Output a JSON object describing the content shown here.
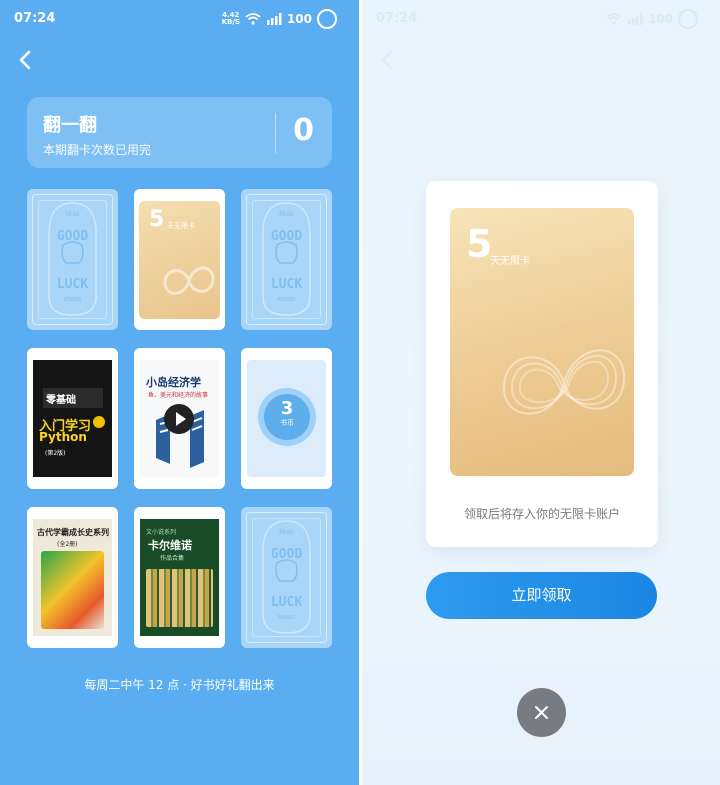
{
  "status_bar": {
    "time": "07:24",
    "net_speed_value": "4.42",
    "net_speed_unit": "KB/S",
    "battery": "100"
  },
  "left": {
    "header": {
      "title": "翻一翻",
      "subtitle": "本期翻卡次数已用完",
      "remaining_count": "0"
    },
    "cards": {
      "card_back_text_top": "READ",
      "card_back_text_good": "GOOD",
      "card_back_text_luck": "LUCK",
      "card_back_text_bottom": "REWARD",
      "unlimited_card_days": "5",
      "unlimited_card_label": "天无限卡",
      "python_book_title_line1": "零基础",
      "python_book_title_line2": "入门学习",
      "python_book_title_line3": "Python",
      "python_book_edition": "(第2版)",
      "econ_book_title": "小岛经济学",
      "econ_book_subtitle": "鱼、美元和经济的故事",
      "coin_amount": "3",
      "coin_unit": "书币",
      "history_book_title": "古代学霸成长史系列",
      "history_book_volume": "(全2册)",
      "kaer_book_series": "文小说系列",
      "kaer_book_title": "卡尔维诺",
      "kaer_book_subtitle": "作品合集"
    },
    "footer_note": "每周二中午 12 点 · 好书好礼翻出来"
  },
  "right": {
    "reward_card": {
      "days": "5",
      "label": "天无限卡"
    },
    "note": "领取后将存入你的无限卡账户",
    "claim_button": "立即领取"
  },
  "icons": {
    "back": "chevron-left-icon",
    "wifi": "wifi-icon",
    "signal": "signal-icon",
    "battery": "battery-icon",
    "play": "play-icon",
    "close": "close-icon",
    "infinity": "infinity-icon"
  },
  "colors": {
    "left_background": "#5aadf1",
    "card_back": "#a9d6f8",
    "gold_card": "#edcb93",
    "claim_button": "#2d9bef",
    "close_button": "#787c82"
  }
}
